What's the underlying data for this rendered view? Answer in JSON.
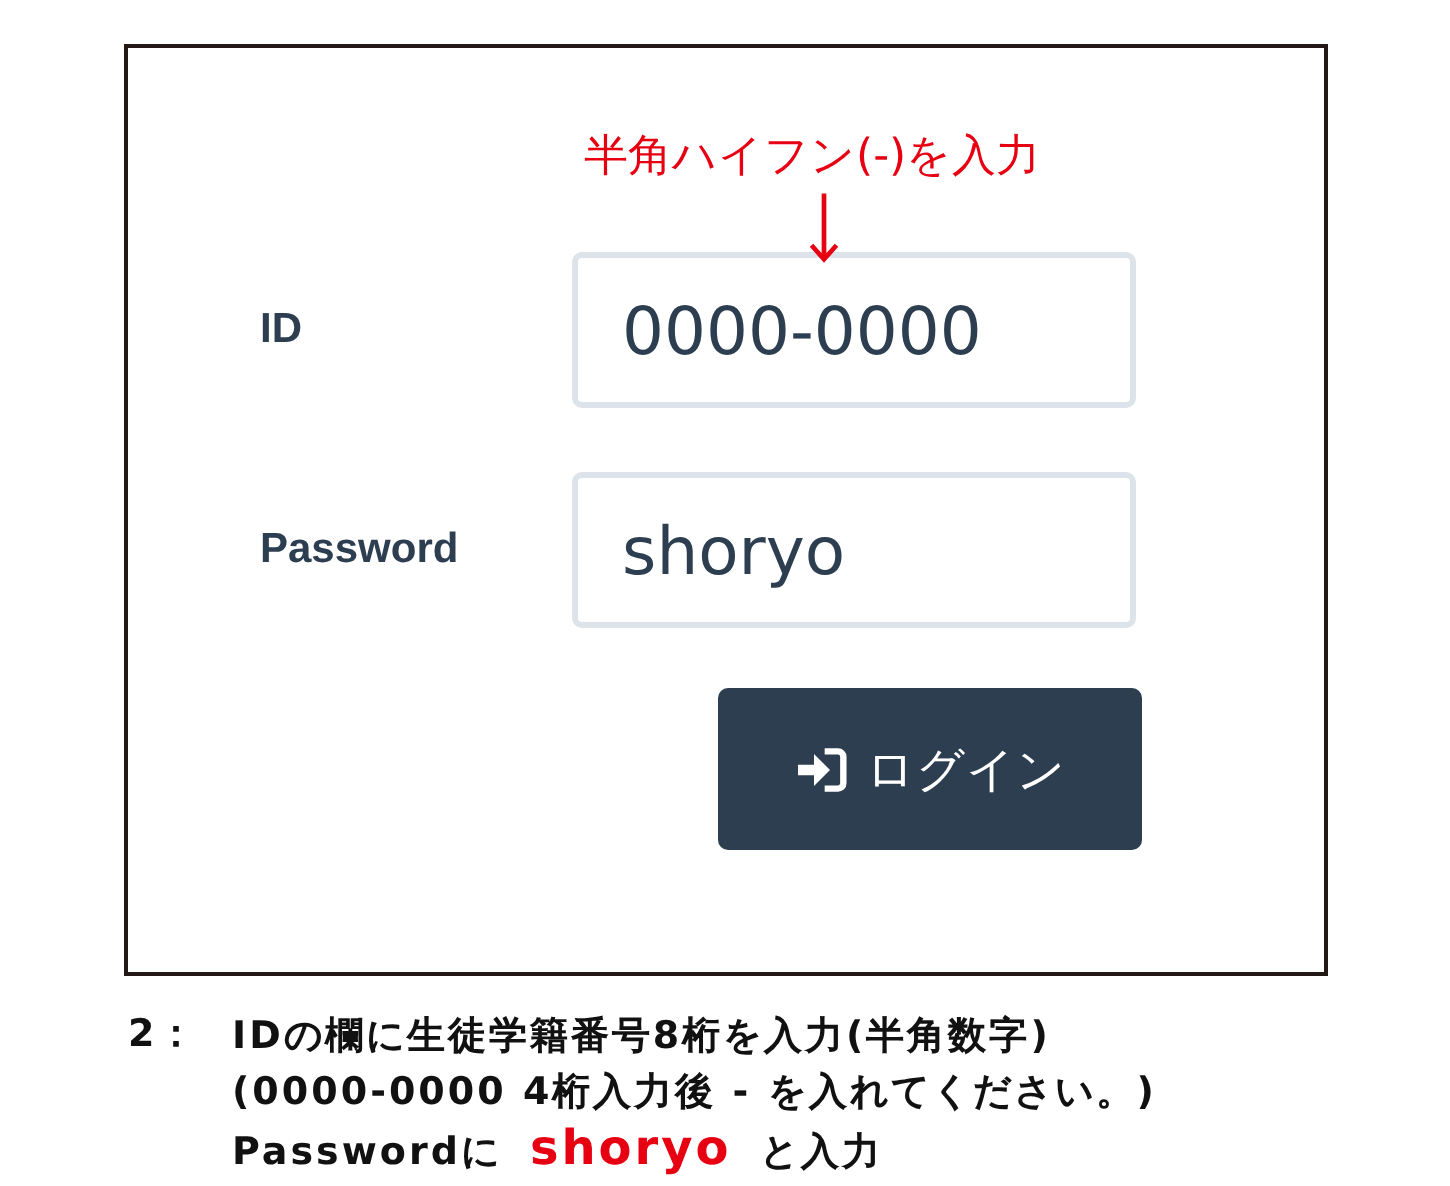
{
  "annotation": {
    "text": "半角ハイフン(-)を入力"
  },
  "form": {
    "fields": [
      {
        "label": "ID",
        "value": "0000-0000"
      },
      {
        "label": "Password",
        "value": "shoryo"
      }
    ],
    "button": {
      "label": "ログイン"
    }
  },
  "caption": {
    "step": "2：",
    "lines": [
      {
        "text": "IDの欄に生徒学籍番号8桁を入力(半角数字)"
      },
      {
        "text": "(0000-0000 4桁入力後 - を入れてください。)"
      },
      {
        "text": "Passwordに",
        "highlight": "shoryo",
        "after": "と入力"
      }
    ]
  }
}
